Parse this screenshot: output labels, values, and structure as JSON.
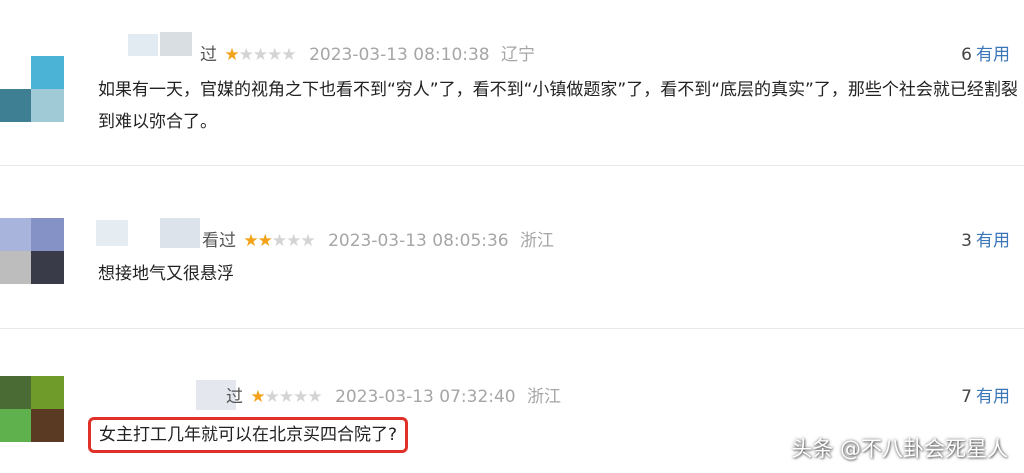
{
  "comments": [
    {
      "status": "过",
      "stars_on": 1,
      "stars_total": 5,
      "date": "2023-03-13 08:10:38",
      "location": "辽宁",
      "useful_count": "6",
      "useful_label": "有用",
      "text": "如果有一天，官媒的视角之下也看不到“穷人”了，看不到“小镇做题家”了，看不到“底层的真实”了，那些个社会就已经割裂到难以弥合了。",
      "avatar_colors": [
        "#ffffff",
        "#4ab3d6",
        "#3f7f94",
        "#9fcad6"
      ]
    },
    {
      "status": "看过",
      "stars_on": 2,
      "stars_total": 5,
      "date": "2023-03-13 08:05:36",
      "location": "浙江",
      "useful_count": "3",
      "useful_label": "有用",
      "text": "想接地气又很悬浮",
      "avatar_colors": [
        "#a8b4dc",
        "#8492c6",
        "#bdbdbd",
        "#3a3b48"
      ]
    },
    {
      "status": "过",
      "stars_on": 1,
      "stars_total": 5,
      "date": "2023-03-13 07:32:40",
      "location": "浙江",
      "useful_count": "7",
      "useful_label": "有用",
      "text": "女主打工几年就可以在北京买四合院了?",
      "avatar_colors": [
        "#4a6b34",
        "#6e9b2a",
        "#5fb14e",
        "#5a3a22"
      ]
    }
  ],
  "watermark": "头条 @不八卦会死星人",
  "colors": {
    "star_on": "#f3a31a",
    "star_off": "#d4d4d4",
    "link": "#3a76b8",
    "highlight_border": "#e0302a"
  }
}
